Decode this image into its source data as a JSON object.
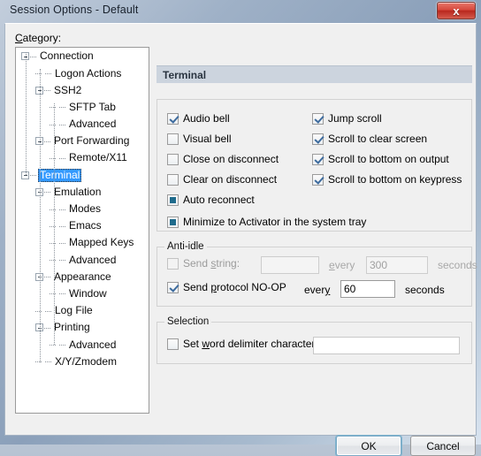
{
  "window": {
    "title": "Session Options - Default",
    "close_label": "x",
    "accent_selection": "#3399ff",
    "header_bg": "#ccd4de"
  },
  "category": {
    "label": "Category:",
    "tree": [
      {
        "label": "Connection",
        "indent": 0,
        "expander": "collapse",
        "selected": false
      },
      {
        "label": "Logon Actions",
        "indent": 1,
        "expander": "none",
        "selected": false
      },
      {
        "label": "SSH2",
        "indent": 1,
        "expander": "collapse",
        "selected": false
      },
      {
        "label": "SFTP Tab",
        "indent": 2,
        "expander": "none",
        "selected": false
      },
      {
        "label": "Advanced",
        "indent": 2,
        "expander": "none",
        "selected": false
      },
      {
        "label": "Port Forwarding",
        "indent": 1,
        "expander": "collapse",
        "selected": false
      },
      {
        "label": "Remote/X11",
        "indent": 2,
        "expander": "none",
        "selected": false
      },
      {
        "label": "Terminal",
        "indent": 0,
        "expander": "collapse",
        "selected": true
      },
      {
        "label": "Emulation",
        "indent": 1,
        "expander": "collapse",
        "selected": false
      },
      {
        "label": "Modes",
        "indent": 2,
        "expander": "none",
        "selected": false
      },
      {
        "label": "Emacs",
        "indent": 2,
        "expander": "none",
        "selected": false
      },
      {
        "label": "Mapped Keys",
        "indent": 2,
        "expander": "none",
        "selected": false
      },
      {
        "label": "Advanced",
        "indent": 2,
        "expander": "none",
        "selected": false
      },
      {
        "label": "Appearance",
        "indent": 1,
        "expander": "collapse",
        "selected": false
      },
      {
        "label": "Window",
        "indent": 2,
        "expander": "none",
        "selected": false
      },
      {
        "label": "Log File",
        "indent": 1,
        "expander": "none",
        "selected": false
      },
      {
        "label": "Printing",
        "indent": 1,
        "expander": "collapse",
        "selected": false
      },
      {
        "label": "Advanced",
        "indent": 2,
        "expander": "none",
        "selected": false
      },
      {
        "label": "X/Y/Zmodem",
        "indent": 1,
        "expander": "none",
        "selected": false
      }
    ]
  },
  "panel": {
    "header": "Terminal",
    "checkboxes_left": [
      {
        "label": "Audio bell",
        "state": "checked",
        "enabled": true
      },
      {
        "label": "Visual bell",
        "state": "unchecked",
        "enabled": true
      },
      {
        "label": "Close on disconnect",
        "state": "unchecked",
        "enabled": true
      },
      {
        "label": "Clear on disconnect",
        "state": "unchecked",
        "enabled": true
      },
      {
        "label": "Auto reconnect",
        "state": "filled",
        "enabled": true
      },
      {
        "label": "Minimize to Activator in the system tray",
        "state": "filled",
        "enabled": true
      }
    ],
    "checkboxes_right": [
      {
        "label": "Jump scroll",
        "state": "checked",
        "enabled": true
      },
      {
        "label": "Scroll to clear screen",
        "state": "checked",
        "enabled": true
      },
      {
        "label": "Scroll to bottom on output",
        "state": "checked",
        "enabled": true
      },
      {
        "label": "Scroll to bottom on keypress",
        "state": "checked",
        "enabled": true
      }
    ],
    "anti_idle": {
      "title": "Anti-idle",
      "send_string": {
        "label": "Send string:",
        "state": "unchecked",
        "enabled": false,
        "value": "",
        "every_label": "every",
        "interval": "300",
        "seconds_label": "seconds"
      },
      "send_noop": {
        "label": "Send protocol NO-OP",
        "state": "checked",
        "enabled": true,
        "every_label": "every",
        "interval": "60",
        "seconds_label": "seconds"
      }
    },
    "selection": {
      "title": "Selection",
      "set_word_delimiter": {
        "label": "Set word delimiter characters:",
        "state": "unchecked",
        "enabled": true,
        "value": ""
      }
    }
  },
  "buttons": {
    "ok": "OK",
    "cancel": "Cancel"
  }
}
